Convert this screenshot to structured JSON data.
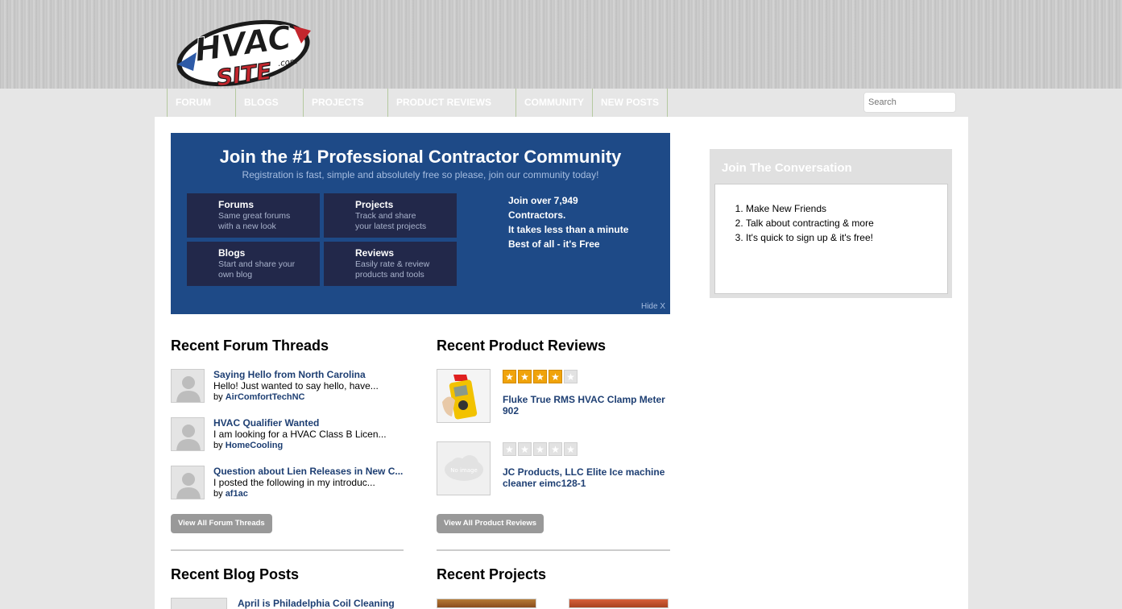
{
  "header": {
    "logo_text_top": "HVAC",
    "logo_text_bottom": "SITE",
    "logo_domain": ".com"
  },
  "nav": [
    "FORUM",
    "BLOGS",
    "PROJECTS",
    "PRODUCT REVIEWS",
    "COMMUNITY",
    "NEW POSTS"
  ],
  "search": {
    "placeholder": "Search"
  },
  "banner": {
    "title": "Join the #1 Professional Contractor Community",
    "subtitle": "Registration is fast, simple and absolutely free so please, join our community today!",
    "tiles": [
      {
        "title": "Forums",
        "desc1": "Same great forums",
        "desc2": "with a new look"
      },
      {
        "title": "Projects",
        "desc1": "Track and share",
        "desc2": "your latest projects"
      },
      {
        "title": "Blogs",
        "desc1": "Start and share your",
        "desc2": "own blog"
      },
      {
        "title": "Reviews",
        "desc1": "Easily rate & review",
        "desc2": "products and tools"
      }
    ],
    "join_lines": [
      "Join over 7,949",
      "Contractors.",
      "It takes less than a minute",
      "Best of all - it's Free"
    ],
    "hide": "Hide X"
  },
  "sidebar": {
    "title": "Join The Conversation",
    "items": [
      "Make New Friends",
      "Talk about contracting & more",
      "It's quick to sign up & it's free!"
    ]
  },
  "forum": {
    "title": "Recent Forum Threads",
    "threads": [
      {
        "title": "Saying Hello from North Carolina",
        "excerpt": "Hello! Just wanted to say hello, have...",
        "by_label": "by",
        "author": "AirComfortTechNC"
      },
      {
        "title": "HVAC Qualifier Wanted",
        "excerpt": "I am looking for a HVAC Class B Licen...",
        "by_label": "by",
        "author": "HomeCooling"
      },
      {
        "title": "Question about Lien Releases in New C...",
        "excerpt": "I posted the following in my introduc...",
        "by_label": "by",
        "author": "af1ac"
      }
    ],
    "button": "View All Forum Threads"
  },
  "reviews": {
    "title": "Recent Product Reviews",
    "items": [
      {
        "title": "Fluke True RMS HVAC Clamp Meter 902",
        "rating": 4,
        "max": 5,
        "thumb": "clamp-meter-image"
      },
      {
        "title": "JC Products, LLC Elite Ice machine cleaner eimc128-1",
        "rating": 0,
        "max": 5,
        "thumb": "no-image",
        "thumb_text": "No image"
      }
    ],
    "button": "View All Product Reviews"
  },
  "blog": {
    "title": "Recent Blog Posts",
    "first_post": "April is Philadelphia Coil Cleaning"
  },
  "projects": {
    "title": "Recent Projects"
  },
  "colors": {
    "nav_text": "#ffffff",
    "banner_bg": "#1e4a87",
    "tile_bg": "#22284a",
    "link": "#1e3f73",
    "star_on": "#f0a30a"
  }
}
